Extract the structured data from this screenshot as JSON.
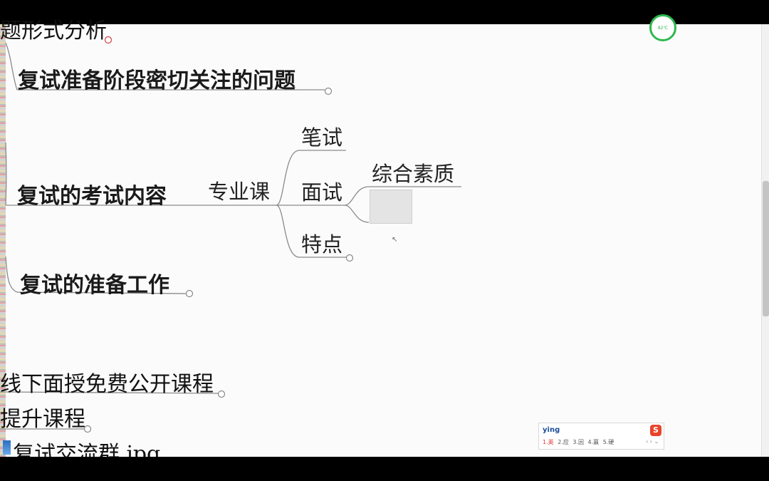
{
  "mindmap": {
    "partial_top": "题形式分析",
    "n1": "复试准备阶段密切关注的问题",
    "n2": "复试的考试内容",
    "n3": "复试的准备工作",
    "child_major": "专业课",
    "child_written": "笔试",
    "child_interview": "面试",
    "child_feature": "特点",
    "child_quality": "综合素质",
    "partial_1": "线下面授免费公开课程",
    "partial_2": "提升课程",
    "partial_3": "复试交流群.jpg"
  },
  "ime": {
    "input": "ying",
    "candidates_first": "1.英",
    "candidates_rest": "2.应 3.因 4.嬴 5.硬",
    "logo": "S",
    "arrows": "‹ › ⌄"
  },
  "status_ring": {
    "text": "82℃"
  },
  "colors": {
    "background": "#fbfbfb",
    "ring": "#2db84d",
    "line": "#888888"
  }
}
